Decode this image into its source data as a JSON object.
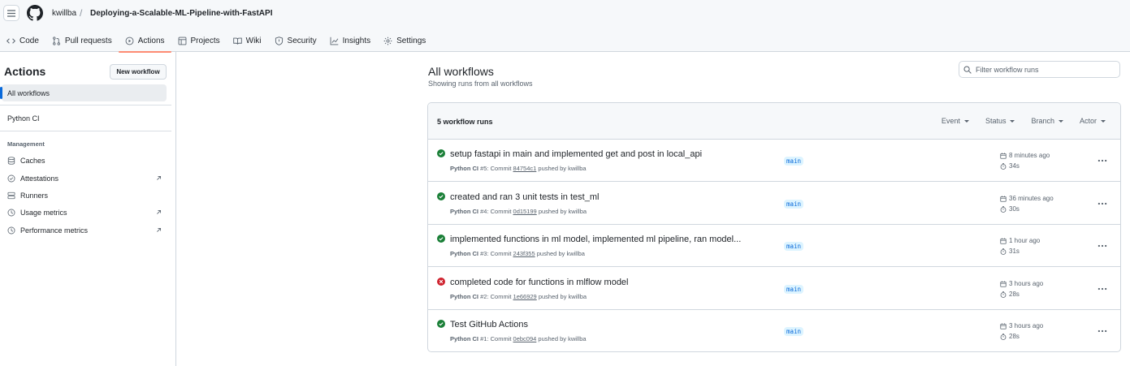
{
  "header": {
    "owner": "kwillba",
    "separator": "/",
    "repo": "Deploying-a-Scalable-ML-Pipeline-with-FastAPI"
  },
  "tabs": [
    {
      "label": "Code",
      "icon": "code-icon"
    },
    {
      "label": "Pull requests",
      "icon": "pull-request-icon"
    },
    {
      "label": "Actions",
      "icon": "play-icon",
      "selected": true
    },
    {
      "label": "Projects",
      "icon": "table-icon"
    },
    {
      "label": "Wiki",
      "icon": "book-icon"
    },
    {
      "label": "Security",
      "icon": "shield-icon"
    },
    {
      "label": "Insights",
      "icon": "graph-icon"
    },
    {
      "label": "Settings",
      "icon": "gear-icon"
    }
  ],
  "sidebar": {
    "title": "Actions",
    "new_workflow": "New workflow",
    "all_workflows": "All workflows",
    "workflows": [
      "Python CI"
    ],
    "management_label": "Management",
    "management": [
      {
        "label": "Caches",
        "icon": "database-icon"
      },
      {
        "label": "Attestations",
        "icon": "verified-icon",
        "external": true
      },
      {
        "label": "Runners",
        "icon": "server-icon"
      },
      {
        "label": "Usage metrics",
        "icon": "clock-icon",
        "external": true
      },
      {
        "label": "Performance metrics",
        "icon": "clock-icon",
        "external": true
      }
    ]
  },
  "main": {
    "title": "All workflows",
    "subtitle": "Showing runs from all workflows",
    "filter_placeholder": "Filter workflow runs",
    "runs_count": "5 workflow runs",
    "filters": [
      "Event",
      "Status",
      "Branch",
      "Actor"
    ],
    "runs": [
      {
        "status": "success",
        "title": "setup fastapi in main and implemented get and post in local_api",
        "workflow": "Python CI",
        "number": "#5",
        "commit_label": ": Commit",
        "commit": "84754c1",
        "pushed": "pushed by kwillba",
        "branch": "main",
        "when": "8 minutes ago",
        "duration": "34s"
      },
      {
        "status": "success",
        "title": "created and ran 3 unit tests in test_ml",
        "workflow": "Python CI",
        "number": "#4",
        "commit_label": ": Commit",
        "commit": "0d15199",
        "pushed": "pushed by kwillba",
        "branch": "main",
        "when": "36 minutes ago",
        "duration": "30s"
      },
      {
        "status": "success",
        "title": "implemented functions in ml model, implemented ml pipeline, ran model...",
        "workflow": "Python CI",
        "number": "#3",
        "commit_label": ": Commit",
        "commit": "243f355",
        "pushed": "pushed by kwillba",
        "branch": "main",
        "when": "1 hour ago",
        "duration": "31s"
      },
      {
        "status": "failure",
        "title": "completed code for functions in mlflow model",
        "workflow": "Python CI",
        "number": "#2",
        "commit_label": ": Commit",
        "commit": "1e66929",
        "pushed": "pushed by kwillba",
        "branch": "main",
        "when": "3 hours ago",
        "duration": "28s"
      },
      {
        "status": "success",
        "title": "Test GitHub Actions",
        "workflow": "Python CI",
        "number": "#1",
        "commit_label": ": Commit",
        "commit": "0ebc094",
        "pushed": "pushed by kwillba",
        "branch": "main",
        "when": "3 hours ago",
        "duration": "28s"
      }
    ]
  },
  "colors": {
    "success": "#1a7f37",
    "failure": "#cf222e",
    "accent": "#0969da",
    "tab_underline": "#fd8c73"
  }
}
